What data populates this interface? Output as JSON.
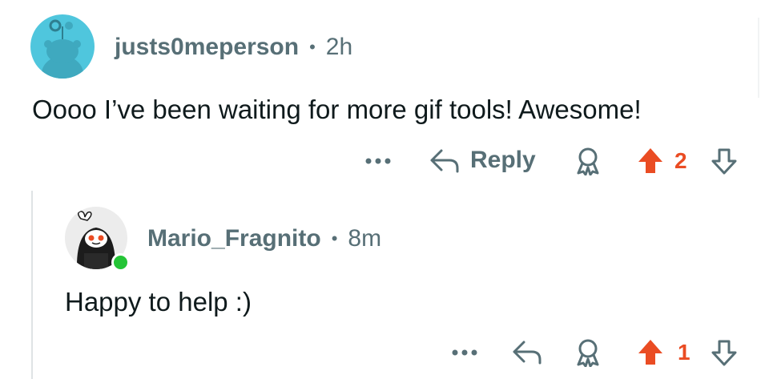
{
  "comments": [
    {
      "username": "justs0meperson",
      "separator": "•",
      "time": "2h",
      "text": "Oooo I’ve been waiting for more gif tools! Awesome!",
      "reply_label": "Reply",
      "score": "2",
      "vote_state": "upvoted",
      "avatar": "snoo-avatar-cyan"
    },
    {
      "username": "Mario_Fragnito",
      "separator": "•",
      "time": "8m",
      "text": "Happy to help :)",
      "score": "1",
      "vote_state": "upvoted",
      "online": true,
      "avatar": "snoo-avatar-hooded"
    }
  ],
  "icons": {
    "more": "more-icon",
    "reply": "reply-arrow-icon",
    "award": "award-icon",
    "upvote": "upvote-icon",
    "downvote": "downvote-icon"
  },
  "colors": {
    "upvote_active": "#ea4c23",
    "meta_text": "#576f76",
    "online": "#24c436",
    "avatar_bg_cyan": "#4fc6dd"
  }
}
